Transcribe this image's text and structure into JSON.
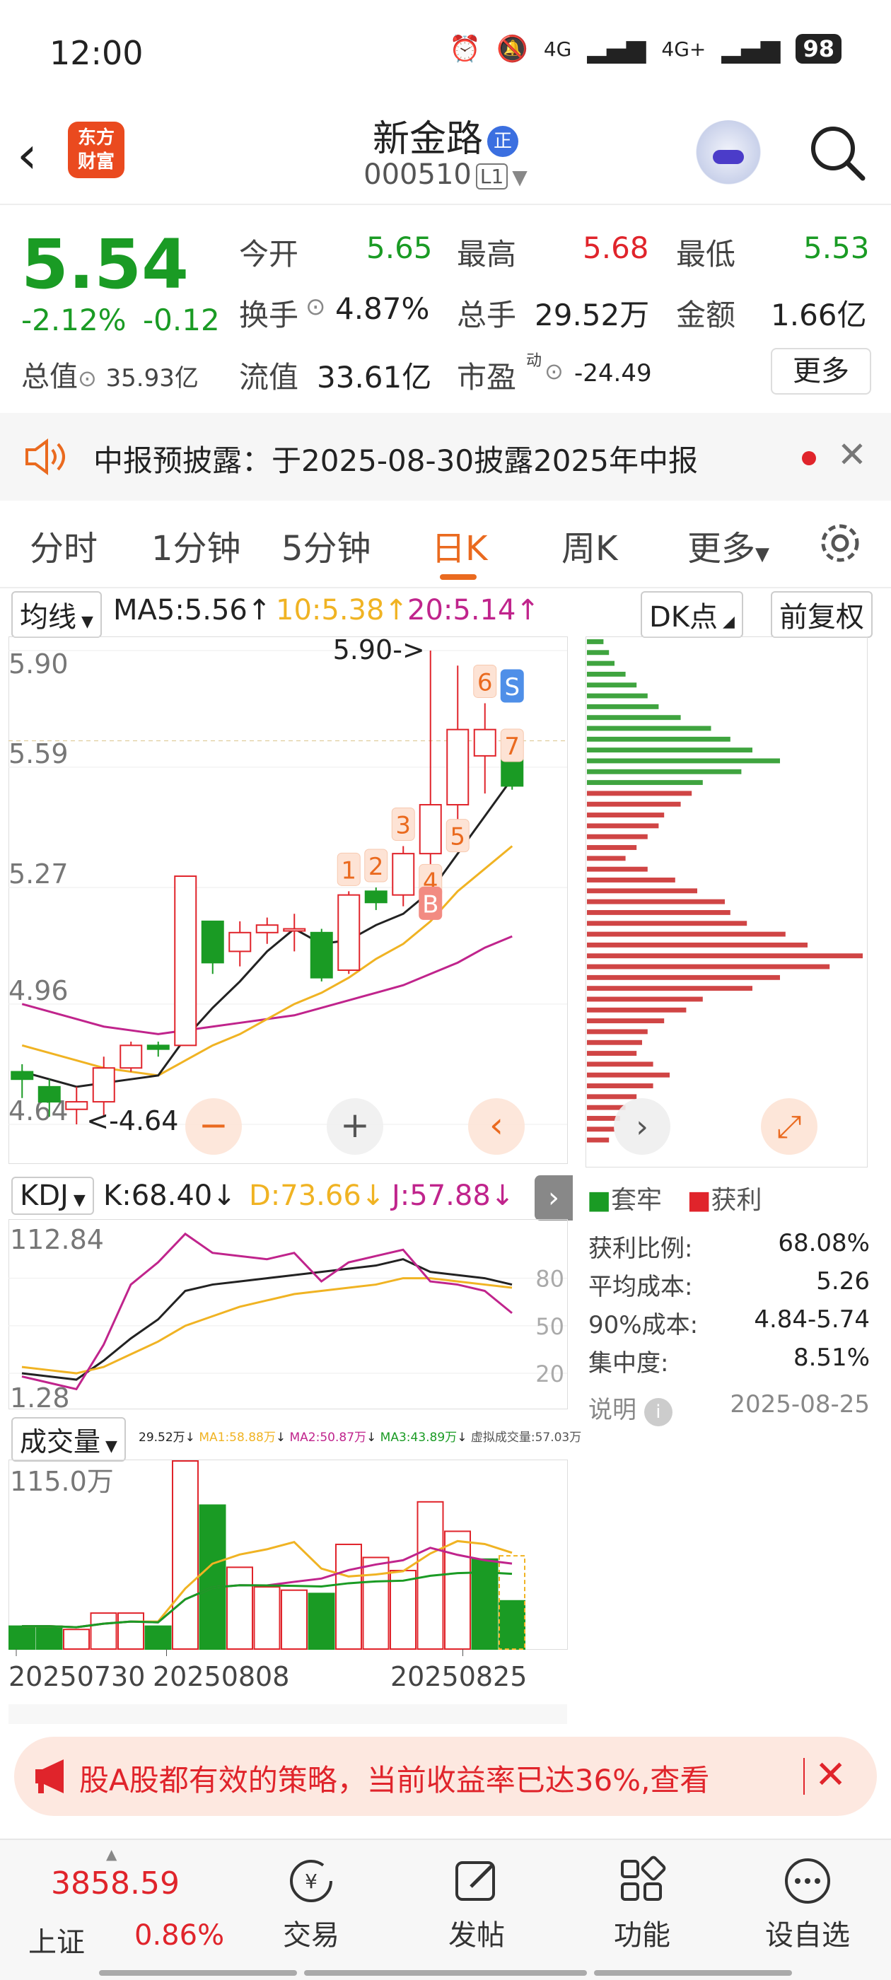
{
  "status_bar": {
    "time": "12:00",
    "network_1": "4G",
    "network_2": "4G+",
    "battery": "98"
  },
  "header": {
    "logo_text_1": "东方",
    "logo_text_2": "财富",
    "stock_name": "新金路",
    "badge": "正",
    "stock_code": "000510",
    "level": "L1"
  },
  "quote": {
    "price": "5.54",
    "change_pct": "-2.12%",
    "change": "-0.12",
    "open_label": "今开",
    "open": "5.65",
    "high_label": "最高",
    "high": "5.68",
    "low_label": "最低",
    "low": "5.53",
    "turnover_label": "换手",
    "turnover": "4.87%",
    "volume_label": "总手",
    "volume": "29.52万",
    "amount_label": "金额",
    "amount": "1.66亿",
    "mktcap_label": "总值",
    "mktcap": "35.93亿",
    "float_label": "流值",
    "float_cap": "33.61亿",
    "pe_label": "市盈",
    "pe_sup": "动",
    "pe": "-24.49",
    "more_label": "更多"
  },
  "notice": {
    "text": "中报预披露：于2025-08-30披露2025年中报"
  },
  "tabs": [
    {
      "label": "分时"
    },
    {
      "label": "1分钟"
    },
    {
      "label": "5分钟"
    },
    {
      "label": "日K"
    },
    {
      "label": "周K"
    },
    {
      "label": "更多"
    }
  ],
  "ma_row": {
    "selector": "均线",
    "ma5": "MA5:5.56",
    "ma10": "10:5.38",
    "ma20": "20:5.14",
    "dk": "DK点",
    "adjust": "前复权"
  },
  "colors": {
    "up": "#e0242b",
    "down": "#1a9b24",
    "accent": "#ea6a1f",
    "ma5": "#222222",
    "ma10": "#f0b323",
    "ma20": "#c0248c"
  },
  "chart_data": [
    {
      "type": "candlestick",
      "ylim": [
        4.64,
        5.9
      ],
      "y_tick_labels": [
        "5.90",
        "5.59",
        "5.27",
        "4.96",
        "4.64"
      ],
      "max_marker": "5.90->",
      "min_marker": "<-4.64",
      "reference_price": 5.66,
      "candles": [
        {
          "open": 4.78,
          "close": 4.76,
          "high": 4.8,
          "low": 4.71
        },
        {
          "open": 4.74,
          "close": 4.7,
          "high": 4.76,
          "low": 4.66
        },
        {
          "open": 4.68,
          "close": 4.7,
          "high": 4.74,
          "low": 4.64
        },
        {
          "open": 4.7,
          "close": 4.79,
          "high": 4.82,
          "low": 4.66
        },
        {
          "open": 4.79,
          "close": 4.85,
          "high": 4.86,
          "low": 4.78
        },
        {
          "open": 4.85,
          "close": 4.84,
          "high": 4.86,
          "low": 4.82
        },
        {
          "open": 4.85,
          "close": 5.3,
          "high": 5.3,
          "low": 4.85
        },
        {
          "open": 5.18,
          "close": 5.07,
          "high": 5.18,
          "low": 5.04
        },
        {
          "open": 5.1,
          "close": 5.15,
          "high": 5.18,
          "low": 5.06
        },
        {
          "open": 5.15,
          "close": 5.17,
          "high": 5.19,
          "low": 5.12
        },
        {
          "open": 5.16,
          "close": 5.16,
          "high": 5.2,
          "low": 5.1
        },
        {
          "open": 5.15,
          "close": 5.03,
          "high": 5.16,
          "low": 5.02
        },
        {
          "open": 5.05,
          "close": 5.25,
          "high": 5.26,
          "low": 5.04
        },
        {
          "open": 5.26,
          "close": 5.23,
          "high": 5.27,
          "low": 5.21
        },
        {
          "open": 5.25,
          "close": 5.36,
          "high": 5.38,
          "low": 5.22
        },
        {
          "open": 5.36,
          "close": 5.49,
          "high": 5.9,
          "low": 5.32
        },
        {
          "open": 5.49,
          "close": 5.69,
          "high": 5.86,
          "low": 5.44
        },
        {
          "open": 5.62,
          "close": 5.69,
          "high": 5.76,
          "low": 5.52
        },
        {
          "open": 5.67,
          "close": 5.54,
          "high": 5.68,
          "low": 5.53
        }
      ],
      "ma5": [
        4.78,
        4.76,
        4.74,
        4.75,
        4.76,
        4.77,
        4.87,
        4.95,
        5.02,
        5.1,
        5.16,
        5.12,
        5.13,
        5.17,
        5.2,
        5.26,
        5.36,
        5.46,
        5.56
      ],
      "ma10": [
        4.85,
        4.83,
        4.81,
        4.79,
        4.78,
        4.77,
        4.81,
        4.85,
        4.88,
        4.92,
        4.96,
        4.99,
        5.03,
        5.08,
        5.12,
        5.18,
        5.26,
        5.32,
        5.38
      ],
      "ma20": [
        4.96,
        4.94,
        4.92,
        4.9,
        4.89,
        4.88,
        4.89,
        4.9,
        4.91,
        4.92,
        4.93,
        4.95,
        4.97,
        4.99,
        5.01,
        5.04,
        5.07,
        5.11,
        5.14
      ],
      "signals": [
        {
          "label": "1",
          "index": 12
        },
        {
          "label": "2",
          "index": 13
        },
        {
          "label": "3",
          "index": 14
        },
        {
          "label": "4",
          "index": 15
        },
        {
          "label": "5",
          "index": 16
        },
        {
          "label": "6",
          "index": 17
        },
        {
          "label": "7",
          "index": 18
        },
        {
          "label": "B",
          "index": 15
        },
        {
          "label": "S",
          "index": 18
        }
      ]
    },
    {
      "type": "bar",
      "title": "chip distribution",
      "legend": [
        "套牢",
        "获利"
      ],
      "profit_ratio_label": "获利比例:",
      "profit_ratio": "68.08%",
      "avg_cost_label": "平均成本:",
      "avg_cost": "5.26",
      "cost90_label": "90%成本:",
      "cost90": "4.84-5.74",
      "concentration_label": "集中度:",
      "concentration": "8.51%",
      "note_label": "说明",
      "date": "2025-08-25",
      "green_bars": [
        6,
        8,
        10,
        14,
        18,
        22,
        26,
        34,
        45,
        52,
        60,
        70,
        56,
        42
      ],
      "red_bars": [
        38,
        34,
        28,
        26,
        22,
        18,
        14,
        22,
        32,
        40,
        50,
        52,
        58,
        72,
        80,
        100,
        88,
        70,
        60,
        42,
        36,
        28,
        22,
        20,
        18,
        24,
        30,
        24,
        18,
        14,
        12,
        10,
        8
      ]
    },
    {
      "type": "line",
      "title": "KDJ",
      "selector": "KDJ",
      "k_label": "K:68.40",
      "d_label": "D:73.66",
      "j_label": "J:57.88",
      "ylim": [
        1.28,
        112.84
      ],
      "y_tick_labels": [
        "112.84",
        "1.28"
      ],
      "ref_lines": [
        "80",
        "50",
        "20"
      ],
      "series": [
        {
          "name": "K",
          "values": [
            20,
            18,
            16,
            28,
            42,
            54,
            72,
            76,
            78,
            80,
            82,
            84,
            86,
            88,
            92,
            84,
            82,
            80,
            76
          ]
        },
        {
          "name": "D",
          "values": [
            24,
            22,
            20,
            24,
            32,
            40,
            50,
            56,
            62,
            66,
            70,
            72,
            74,
            76,
            80,
            80,
            78,
            76,
            74
          ]
        },
        {
          "name": "J",
          "values": [
            18,
            14,
            10,
            38,
            76,
            90,
            108,
            96,
            94,
            92,
            96,
            78,
            90,
            94,
            98,
            78,
            76,
            72,
            58
          ]
        }
      ]
    },
    {
      "type": "bar",
      "title": "成交量",
      "selector": "成交量",
      "header_vol": "29.52万",
      "header_ma1": "MA1:58.88万",
      "header_ma2": "MA2:50.87万",
      "header_ma3": "MA3:43.89万",
      "header_virtual": "虚拟成交量:57.03万",
      "ylim_label": "115.0万",
      "x_tick_labels": [
        "20250730",
        "20250808",
        "20250825"
      ],
      "volumes": [
        14,
        14,
        12,
        22,
        22,
        14,
        115,
        88,
        50,
        38,
        36,
        34,
        64,
        56,
        48,
        90,
        72,
        55,
        29.5
      ],
      "up": [
        false,
        false,
        true,
        true,
        true,
        false,
        true,
        false,
        true,
        true,
        true,
        false,
        true,
        true,
        true,
        true,
        true,
        false,
        false
      ]
    }
  ],
  "ad": {
    "text": "股A股都有效的策略，当前收益率已达36%,查看"
  },
  "bottom_nav": {
    "index_value": "3858.59",
    "index_name": "上证",
    "index_pct": "0.86%",
    "items": [
      {
        "label": "交易"
      },
      {
        "label": "发帖"
      },
      {
        "label": "功能"
      },
      {
        "label": "设自选"
      }
    ]
  }
}
